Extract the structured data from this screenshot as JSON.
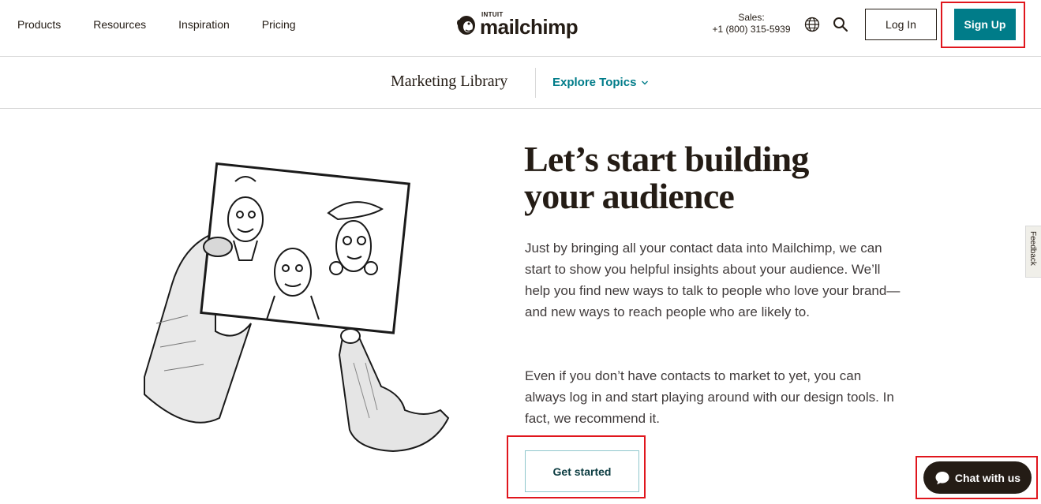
{
  "nav": {
    "links": [
      "Products",
      "Resources",
      "Inspiration",
      "Pricing"
    ],
    "logo_small": "INTUIT",
    "logo_word": "mailchimp",
    "sales_label": "Sales:",
    "sales_phone": "+1 (800) 315-5939",
    "login_label": "Log In",
    "signup_label": "Sign Up"
  },
  "subnav": {
    "title": "Marketing Library",
    "explore_label": "Explore Topics"
  },
  "main": {
    "headline": "Let’s start building your audience",
    "paragraph1": "Just by bringing all your contact data into Mailchimp, we can start to show you helpful insights about your audience. We’ll help you find new ways to talk to people who love your brand—and new ways to reach people who are likely to.",
    "paragraph2": "Even if you don’t have contacts to market to yet, you can always log in and start playing around with our design tools. In fact, we recommend it.",
    "cta_label": "Get started"
  },
  "feedback_label": "Feedback",
  "chat_label": "Chat with us",
  "colors": {
    "accent": "#007c89",
    "text": "#241c15",
    "highlight": "#e0161d"
  }
}
